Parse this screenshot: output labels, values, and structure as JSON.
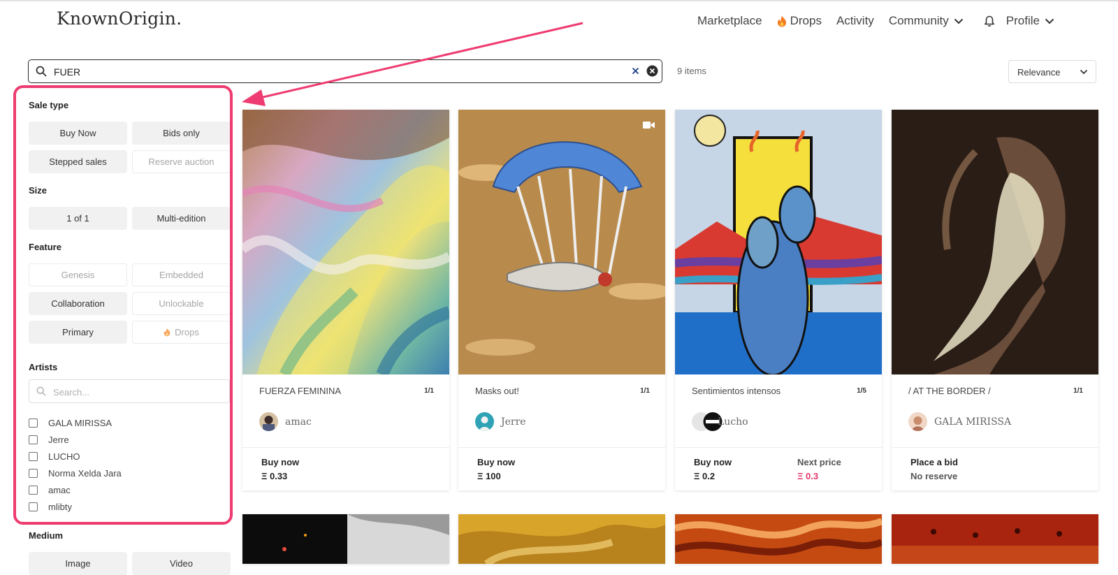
{
  "header": {
    "logo": "KnownOrigin.",
    "nav": {
      "marketplace": "Marketplace",
      "drops": "Drops",
      "activity": "Activity",
      "community": "Community",
      "profile": "Profile"
    }
  },
  "search": {
    "value": "FUER",
    "placeholder": "Search"
  },
  "results": {
    "count_label": "9 items"
  },
  "sort": {
    "selected": "Relevance"
  },
  "sidebar": {
    "sale_type": {
      "title": "Sale type",
      "options": [
        {
          "label": "Buy Now",
          "active": true
        },
        {
          "label": "Bids only",
          "active": true
        },
        {
          "label": "Stepped sales",
          "active": true
        },
        {
          "label": "Reserve auction",
          "active": false
        }
      ]
    },
    "size": {
      "title": "Size",
      "options": [
        {
          "label": "1 of 1",
          "active": true
        },
        {
          "label": "Multi-edition",
          "active": true
        }
      ]
    },
    "feature": {
      "title": "Feature",
      "options": [
        {
          "label": "Genesis",
          "active": false
        },
        {
          "label": "Embedded",
          "active": false
        },
        {
          "label": "Collaboration",
          "active": true
        },
        {
          "label": "Unlockable",
          "active": false
        },
        {
          "label": "Primary",
          "active": true
        },
        {
          "label": "Drops",
          "active": false
        }
      ]
    },
    "artists": {
      "title": "Artists",
      "search_placeholder": "Search...",
      "items": [
        "GALA MIRISSA",
        "Jerre",
        "LUCHO",
        "Norma Xelda Jara",
        "amac",
        "mlibty"
      ]
    },
    "medium": {
      "title": "Medium",
      "options": [
        {
          "label": "Image",
          "active": true
        },
        {
          "label": "Video",
          "active": true
        }
      ]
    }
  },
  "cards": [
    {
      "title": "FUERZA FEMININA",
      "edition": "1/1",
      "creator": "amac",
      "price_label": "Buy now",
      "price_value": "Ξ 0.33"
    },
    {
      "title": "Masks out!",
      "edition": "1/1",
      "creator": "Jerre",
      "price_label": "Buy now",
      "price_value": "Ξ 100",
      "has_video_icon": true
    },
    {
      "title": "Sentimientos intensos",
      "edition": "1/5",
      "creator": "Lucho",
      "price_label": "Buy now",
      "price_value": "Ξ 0.2",
      "next_label": "Next price",
      "next_value": "Ξ 0.3"
    },
    {
      "title": "/ AT THE BORDER /",
      "edition": "1/1",
      "creator": "GALA MIRISSA",
      "price_label": "Place a bid",
      "price_value": "No reserve"
    }
  ],
  "colors": {
    "annotation": "#ee3b70",
    "next_price": "#e3386b",
    "drops_flame": "#f47b20"
  }
}
